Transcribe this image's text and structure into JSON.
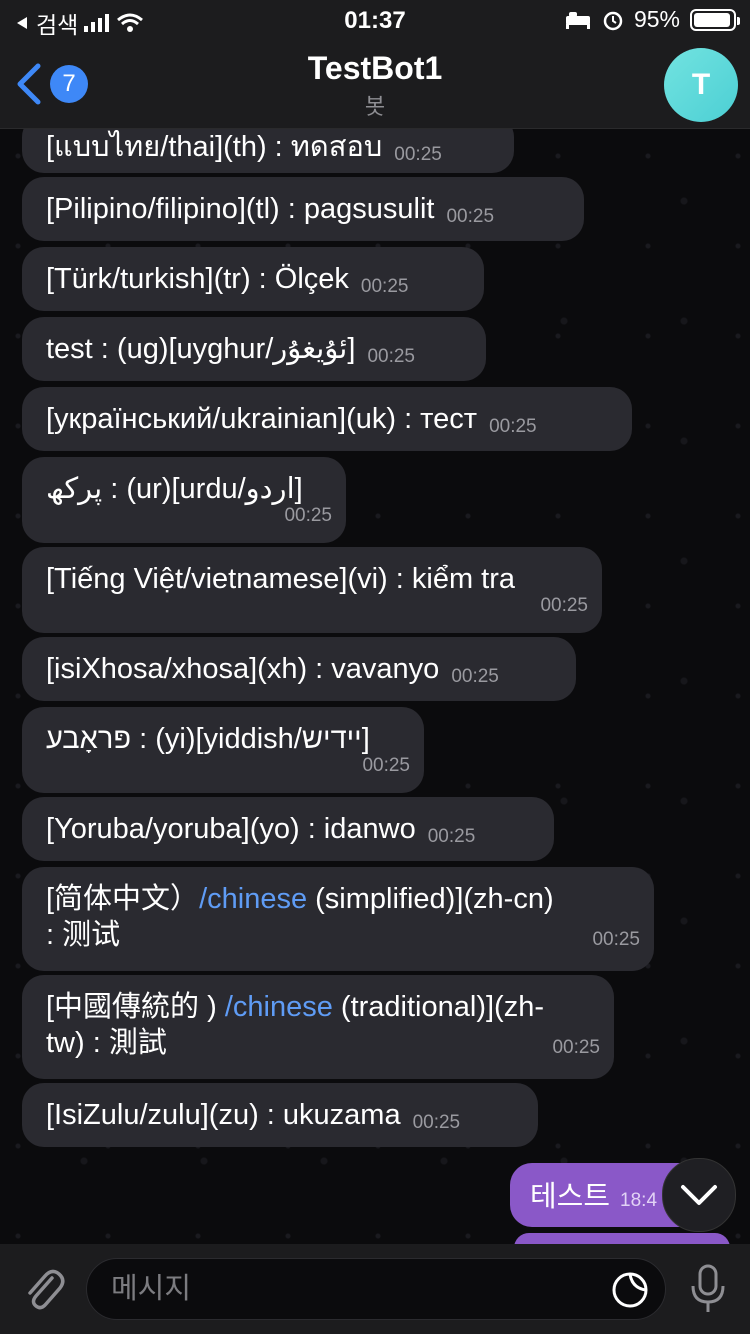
{
  "status_bar": {
    "back_app": "검색",
    "time": "01:37",
    "battery": "95%",
    "battery_level": 0.95
  },
  "header": {
    "back_count": "7",
    "title": "TestBot1",
    "subtitle": "봇",
    "avatar_letter": "T"
  },
  "messages": [
    {
      "text": "[แบบไทย/thai](th) : ทดสอบ",
      "time": "00:25"
    },
    {
      "text": "[Pilipino/filipino](tl) : pagsusulit",
      "time": "00:25"
    },
    {
      "text": "[Türk/turkish](tr) : Ölçek",
      "time": "00:25"
    },
    {
      "text": "test : (ug)[uyghur/ئۇيغۇر]",
      "time": "00:25"
    },
    {
      "text": "[український/ukrainian](uk) : тест",
      "time": "00:25"
    },
    {
      "text": "پرکھ : (ur)[urdu/اردو]",
      "time": "00:25"
    },
    {
      "text": "[Tiếng Việt/vietnamese](vi) : kiểm tra",
      "time": "00:25"
    },
    {
      "text": "[isiXhosa/xhosa](xh) : vavanyo",
      "time": "00:25"
    },
    {
      "text": "פּראָבע : (yi)[yiddish/יידיש]",
      "time": "00:25"
    },
    {
      "text": "[Yoruba/yoruba](yo) : idanwo",
      "time": "00:25"
    },
    {
      "pre": "[简体中文）",
      "link": "/chinese",
      "post": " (simplified)](zh-cn)",
      "line2": ": 测试",
      "time": "00:25"
    },
    {
      "pre": "[中國傳統的 ) ",
      "link": "/chinese",
      "post": " (traditional)](zh-",
      "line2": "tw) : 測試",
      "time": "00:25"
    },
    {
      "text": "[IsiZulu/zulu](zu) : ukuzama",
      "time": "00:25"
    }
  ],
  "outgoing": {
    "text": "테스트",
    "time": "18:4"
  },
  "input": {
    "placeholder": "메시지"
  },
  "colors": {
    "link": "#5f9cf5",
    "outgoing_bubble": "#8a58c8",
    "incoming_bubble": "#2a2a30",
    "accent": "#3e88f7"
  },
  "icons": {
    "back": "chevron-left-icon",
    "attach": "paperclip-icon",
    "sticker": "sticker-icon",
    "mic": "microphone-icon",
    "scroll": "chevron-down-icon"
  }
}
